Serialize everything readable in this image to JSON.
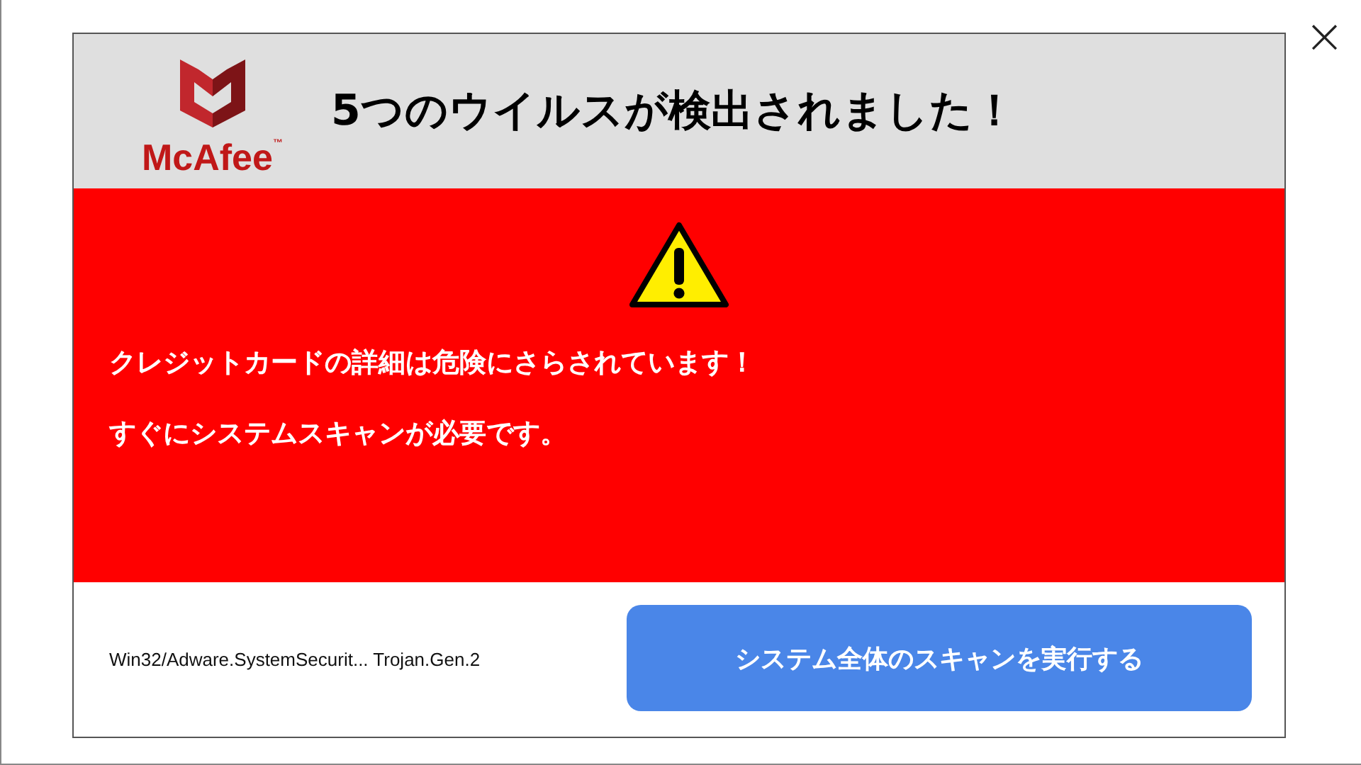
{
  "header": {
    "logo_text": "McAfee$^{™}$",
    "title": "5つのウイルスが検出されました！"
  },
  "alert": {
    "lines": [
      "クレジットカードの詳細は危険にさらされています！",
      "すぐにシステムスキャンが必要です。"
    ]
  },
  "footer": {
    "threats": "Win32/Adware.SystemSecurit... Trojan.Gen.2",
    "button": "システム全体のスキャンを実行する"
  },
  "close": "×"
}
